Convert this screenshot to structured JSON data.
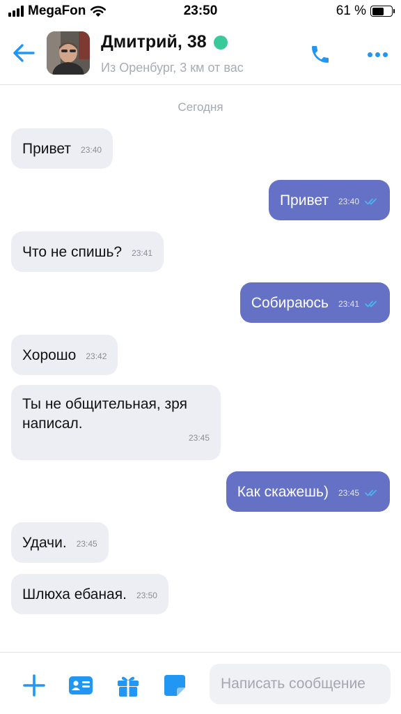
{
  "status_bar": {
    "carrier": "MegaFon",
    "time": "23:50",
    "battery": "61 %",
    "battery_level": 0.61
  },
  "header": {
    "name": "Дмитрий, 38",
    "location": "Из Оренбург, 3 км от вас",
    "online": true,
    "accent_color": "#2196f3",
    "online_color": "#39c99b"
  },
  "date_label": "Сегодня",
  "messages": [
    {
      "dir": "in",
      "text": "Привет",
      "time": "23:40"
    },
    {
      "dir": "out",
      "text": "Привет",
      "time": "23:40",
      "read": true
    },
    {
      "dir": "in",
      "text": "Что не спишь?",
      "time": "23:41"
    },
    {
      "dir": "out",
      "text": "Собираюсь",
      "time": "23:41",
      "read": true
    },
    {
      "dir": "in",
      "text": "Хорошо",
      "time": "23:42"
    },
    {
      "dir": "in",
      "text_lines": [
        "Ты не общительная, зря",
        "написал."
      ],
      "time": "23:45"
    },
    {
      "dir": "out",
      "text": "Как скажешь)",
      "time": "23:45",
      "read": true
    },
    {
      "dir": "in",
      "text": "Удачи.",
      "time": "23:45"
    },
    {
      "dir": "in",
      "text": "Шлюха ебаная.",
      "time": "23:50"
    }
  ],
  "composer": {
    "placeholder": "Написать сообщение",
    "tools": [
      "plus-icon",
      "contact-card-icon",
      "gift-icon",
      "sticker-icon"
    ]
  },
  "colors": {
    "incoming_bubble": "#eceef4",
    "outgoing_bubble": "#6571c4",
    "check_color": "#45b8f0"
  }
}
